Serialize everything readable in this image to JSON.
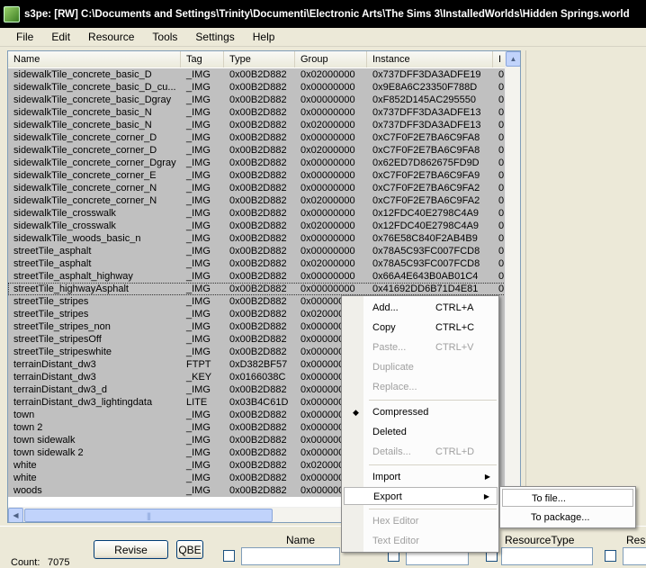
{
  "window": {
    "title": "s3pe: [RW] C:\\Documents and Settings\\Trinity\\Documenti\\Electronic Arts\\The Sims 3\\InstalledWorlds\\Hidden Springs.world"
  },
  "menu": [
    "File",
    "Edit",
    "Resource",
    "Tools",
    "Settings",
    "Help"
  ],
  "list": {
    "columns": [
      "Name",
      "Tag",
      "Type",
      "Group",
      "Instance",
      "I"
    ],
    "rows": [
      {
        "name": "sidewalkTile_concrete_basic_D",
        "tag": "_IMG",
        "type": "0x00B2D882",
        "group": "0x02000000",
        "instance": "0x737DFF3DA3ADFE19",
        "more": "0"
      },
      {
        "name": "sidewalkTile_concrete_basic_D_cu...",
        "tag": "_IMG",
        "type": "0x00B2D882",
        "group": "0x00000000",
        "instance": "0x9E8A6C23350F788D",
        "more": "0"
      },
      {
        "name": "sidewalkTile_concrete_basic_Dgray",
        "tag": "_IMG",
        "type": "0x00B2D882",
        "group": "0x00000000",
        "instance": "0xF852D145AC295550",
        "more": "0"
      },
      {
        "name": "sidewalkTile_concrete_basic_N",
        "tag": "_IMG",
        "type": "0x00B2D882",
        "group": "0x00000000",
        "instance": "0x737DFF3DA3ADFE13",
        "more": "0"
      },
      {
        "name": "sidewalkTile_concrete_basic_N",
        "tag": "_IMG",
        "type": "0x00B2D882",
        "group": "0x02000000",
        "instance": "0x737DFF3DA3ADFE13",
        "more": "0"
      },
      {
        "name": "sidewalkTile_concrete_corner_D",
        "tag": "_IMG",
        "type": "0x00B2D882",
        "group": "0x00000000",
        "instance": "0xC7F0F2E7BA6C9FA8",
        "more": "0"
      },
      {
        "name": "sidewalkTile_concrete_corner_D",
        "tag": "_IMG",
        "type": "0x00B2D882",
        "group": "0x02000000",
        "instance": "0xC7F0F2E7BA6C9FA8",
        "more": "0"
      },
      {
        "name": "sidewalkTile_concrete_corner_Dgray",
        "tag": "_IMG",
        "type": "0x00B2D882",
        "group": "0x00000000",
        "instance": "0x62ED7D862675FD9D",
        "more": "0"
      },
      {
        "name": "sidewalkTile_concrete_corner_E",
        "tag": "_IMG",
        "type": "0x00B2D882",
        "group": "0x00000000",
        "instance": "0xC7F0F2E7BA6C9FA9",
        "more": "0"
      },
      {
        "name": "sidewalkTile_concrete_corner_N",
        "tag": "_IMG",
        "type": "0x00B2D882",
        "group": "0x00000000",
        "instance": "0xC7F0F2E7BA6C9FA2",
        "more": "0"
      },
      {
        "name": "sidewalkTile_concrete_corner_N",
        "tag": "_IMG",
        "type": "0x00B2D882",
        "group": "0x02000000",
        "instance": "0xC7F0F2E7BA6C9FA2",
        "more": "0"
      },
      {
        "name": "sidewalkTile_crosswalk",
        "tag": "_IMG",
        "type": "0x00B2D882",
        "group": "0x00000000",
        "instance": "0x12FDC40E2798C4A9",
        "more": "0"
      },
      {
        "name": "sidewalkTile_crosswalk",
        "tag": "_IMG",
        "type": "0x00B2D882",
        "group": "0x02000000",
        "instance": "0x12FDC40E2798C4A9",
        "more": "0"
      },
      {
        "name": "sidewalkTile_woods_basic_n",
        "tag": "_IMG",
        "type": "0x00B2D882",
        "group": "0x00000000",
        "instance": "0x76E58C840F2AB4B9",
        "more": "0"
      },
      {
        "name": "streetTile_asphalt",
        "tag": "_IMG",
        "type": "0x00B2D882",
        "group": "0x00000000",
        "instance": "0x78A5C93FC007FCD8",
        "more": "0"
      },
      {
        "name": "streetTile_asphalt",
        "tag": "_IMG",
        "type": "0x00B2D882",
        "group": "0x02000000",
        "instance": "0x78A5C93FC007FCD8",
        "more": "0"
      },
      {
        "name": "streetTile_asphalt_highway",
        "tag": "_IMG",
        "type": "0x00B2D882",
        "group": "0x00000000",
        "instance": "0x66A4E643B0AB01C4",
        "more": "0"
      },
      {
        "name": "streetTile_highwayAsphalt",
        "tag": "_IMG",
        "type": "0x00B2D882",
        "group": "0x00000000",
        "instance": "0x41692DD6B71D4E81",
        "more": "0"
      },
      {
        "name": "streetTile_stripes",
        "tag": "_IMG",
        "type": "0x00B2D882",
        "group": "0x000000",
        "instance": "",
        "more": ""
      },
      {
        "name": "streetTile_stripes",
        "tag": "_IMG",
        "type": "0x00B2D882",
        "group": "0x020000",
        "instance": "",
        "more": ""
      },
      {
        "name": "streetTile_stripes_non",
        "tag": "_IMG",
        "type": "0x00B2D882",
        "group": "0x000000",
        "instance": "",
        "more": ""
      },
      {
        "name": "streetTile_stripesOff",
        "tag": "_IMG",
        "type": "0x00B2D882",
        "group": "0x000000",
        "instance": "",
        "more": ""
      },
      {
        "name": "streetTile_stripeswhite",
        "tag": "_IMG",
        "type": "0x00B2D882",
        "group": "0x000000",
        "instance": "",
        "more": ""
      },
      {
        "name": "terrainDistant_dw3",
        "tag": "FTPT",
        "type": "0xD382BF57",
        "group": "0x000000",
        "instance": "",
        "more": ""
      },
      {
        "name": "terrainDistant_dw3",
        "tag": "_KEY",
        "type": "0x0166038C",
        "group": "0x000000",
        "instance": "",
        "more": ""
      },
      {
        "name": "terrainDistant_dw3_d",
        "tag": "_IMG",
        "type": "0x00B2D882",
        "group": "0x000000",
        "instance": "",
        "more": ""
      },
      {
        "name": "terrainDistant_dw3_lightingdata",
        "tag": "LITE",
        "type": "0x03B4C61D",
        "group": "0x000000",
        "instance": "",
        "more": ""
      },
      {
        "name": "town",
        "tag": "_IMG",
        "type": "0x00B2D882",
        "group": "0x000000",
        "instance": "",
        "more": ""
      },
      {
        "name": "town 2",
        "tag": "_IMG",
        "type": "0x00B2D882",
        "group": "0x000000",
        "instance": "",
        "more": ""
      },
      {
        "name": "town sidewalk",
        "tag": "_IMG",
        "type": "0x00B2D882",
        "group": "0x000000",
        "instance": "",
        "more": ""
      },
      {
        "name": "town sidewalk 2",
        "tag": "_IMG",
        "type": "0x00B2D882",
        "group": "0x000000",
        "instance": "",
        "more": ""
      },
      {
        "name": "white",
        "tag": "_IMG",
        "type": "0x00B2D882",
        "group": "0x020000",
        "instance": "",
        "more": ""
      },
      {
        "name": "white",
        "tag": "_IMG",
        "type": "0x00B2D882",
        "group": "0x000000",
        "instance": "",
        "more": ""
      },
      {
        "name": "woods",
        "tag": "_IMG",
        "type": "0x00B2D882",
        "group": "0x000000",
        "instance": "",
        "more": ""
      }
    ]
  },
  "bottom": {
    "count_label": "Count:",
    "count_value": "7075",
    "revise_label": "Revise",
    "qbe_label": "QBE",
    "name_label": "Name",
    "resource_type_label": "ResourceType",
    "reso_label": "Reso"
  },
  "context_menu": {
    "items": [
      {
        "label": "Add...",
        "shortcut": "CTRL+A",
        "disabled": false
      },
      {
        "label": "Copy",
        "shortcut": "CTRL+C",
        "disabled": false
      },
      {
        "label": "Paste...",
        "shortcut": "CTRL+V",
        "disabled": true
      },
      {
        "label": "Duplicate",
        "shortcut": "",
        "disabled": true
      },
      {
        "label": "Replace...",
        "shortcut": "",
        "disabled": true
      },
      {
        "label": "Compressed",
        "shortcut": "",
        "disabled": false,
        "checked": true
      },
      {
        "label": "Deleted",
        "shortcut": "",
        "disabled": false
      },
      {
        "label": "Details...",
        "shortcut": "CTRL+D",
        "disabled": true
      },
      {
        "label": "Import",
        "shortcut": "",
        "disabled": false,
        "submenu": true
      },
      {
        "label": "Export",
        "shortcut": "",
        "disabled": false,
        "submenu": true,
        "active": true
      },
      {
        "label": "Hex Editor",
        "shortcut": "",
        "disabled": true
      },
      {
        "label": "Text Editor",
        "shortcut": "",
        "disabled": true
      }
    ]
  },
  "export_submenu": {
    "to_file": "To file...",
    "to_package": "To package..."
  }
}
